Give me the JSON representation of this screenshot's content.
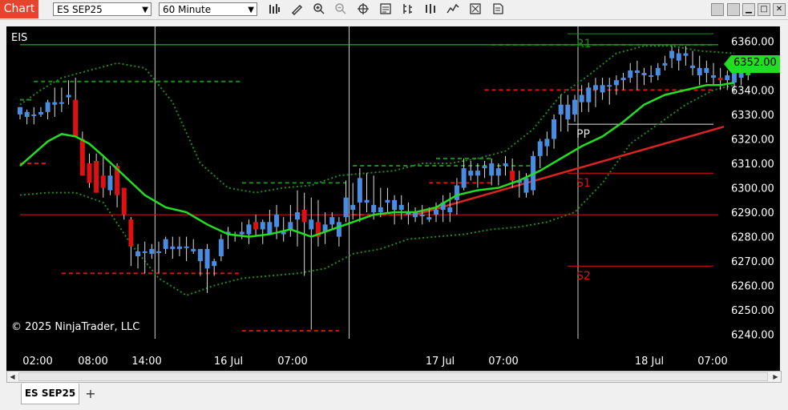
{
  "toolbar": {
    "chart_tab_label": "Chart",
    "instrument": "ES SEP25",
    "interval": "60 Minute",
    "tools": [
      "bar-type-icon",
      "draw-pencil-icon",
      "zoom-in-icon",
      "zoom-out-icon",
      "crosshair-icon",
      "data-box-icon",
      "indicators-icon",
      "strategies-icon",
      "chart-style-icon",
      "properties-icon",
      "templates-icon"
    ],
    "window_buttons": [
      "minimize",
      "restore",
      "maximize",
      "close"
    ]
  },
  "chart": {
    "instrument_label": "EIS",
    "copyright": "© 2025 NinjaTrader, LLC",
    "current_price": "6352.00",
    "pivot_labels": {
      "r1": "R1",
      "pp": "PP",
      "s1": "S1",
      "s2": "S2"
    },
    "colors": {
      "background": "#000000",
      "up_candle": "#22cc22",
      "down_candle": "#dd1111",
      "neutral_candle": "#4a8de0",
      "sma": "#22dd22",
      "bollinger": "#1e8a1e",
      "trendline": "#dd2222",
      "price_marker": "#22dd22"
    }
  },
  "chart_data": {
    "type": "candlestick",
    "ylim": [
      6235,
      6366
    ],
    "y_ticks": [
      "6360.00",
      "6350.00",
      "6340.00",
      "6330.00",
      "6320.00",
      "6310.00",
      "6300.00",
      "6290.00",
      "6280.00",
      "6270.00",
      "6260.00",
      "6250.00",
      "6240.00"
    ],
    "x_ticks": [
      "02:00",
      "08:00",
      "14:00",
      "16 Jul",
      "07:00",
      "17 Jul",
      "07:00",
      "18 Jul",
      "07:00"
    ],
    "candles": [
      [
        6333,
        6333,
        6328,
        6330,
        "b"
      ],
      [
        6331,
        6332,
        6326,
        6329,
        "b"
      ],
      [
        6330,
        6333,
        6326,
        6330,
        "b"
      ],
      [
        6330,
        6333,
        6329,
        6331,
        "b"
      ],
      [
        6331,
        6336,
        6328,
        6335,
        "b"
      ],
      [
        6334,
        6341,
        6329,
        6335,
        "b"
      ],
      [
        6335,
        6341,
        6331,
        6335,
        "b"
      ],
      [
        6338,
        6344,
        6334,
        6337,
        "b"
      ],
      [
        6336,
        6345,
        6330,
        6321,
        "r"
      ],
      [
        6320,
        6323,
        6305,
        6305,
        "r"
      ],
      [
        6310,
        6314,
        6300,
        6302,
        "r"
      ],
      [
        6311,
        6314,
        6298,
        6298,
        "r"
      ],
      [
        6305,
        6313,
        6296,
        6300,
        "r"
      ],
      [
        6299,
        6309,
        6297,
        6305,
        "b"
      ],
      [
        6309,
        6310,
        6292,
        6297,
        "r"
      ],
      [
        6300,
        6300,
        6287,
        6289,
        "r"
      ],
      [
        6287,
        6288,
        6268,
        6276,
        "r"
      ],
      [
        6272,
        6277,
        6267,
        6274,
        "b"
      ],
      [
        6274,
        6278,
        6265,
        6274,
        "b"
      ],
      [
        6273,
        6277,
        6271,
        6275,
        "b"
      ],
      [
        6274,
        6278,
        6265,
        6274,
        "b"
      ],
      [
        6279,
        6280,
        6273,
        6275,
        "b"
      ],
      [
        6275,
        6280,
        6271,
        6276,
        "b"
      ],
      [
        6276,
        6280,
        6272,
        6275,
        "b"
      ],
      [
        6276,
        6280,
        6270,
        6276,
        "b"
      ],
      [
        6274,
        6279,
        6273,
        6275,
        "b"
      ],
      [
        6270,
        6274,
        6264,
        6275,
        "b"
      ],
      [
        6275,
        6277,
        6257,
        6267,
        "b"
      ],
      [
        6268,
        6271,
        6264,
        6270,
        "b"
      ],
      [
        6272,
        6281,
        6270,
        6279,
        "b"
      ],
      [
        6282,
        6284,
        6275,
        6282,
        "b"
      ],
      [
        6281,
        6282,
        6278,
        6281,
        "b"
      ],
      [
        6282,
        6286,
        6279,
        6281,
        "b"
      ],
      [
        6281,
        6287,
        6277,
        6285,
        "b"
      ],
      [
        6286,
        6289,
        6280,
        6283,
        "r"
      ],
      [
        6283,
        6287,
        6277,
        6286,
        "b"
      ],
      [
        6286,
        6291,
        6281,
        6281,
        "b"
      ],
      [
        6289,
        6293,
        6279,
        6284,
        "b"
      ],
      [
        6282,
        6288,
        6278,
        6281,
        "b"
      ],
      [
        6283,
        6293,
        6280,
        6286,
        "b"
      ],
      [
        6287,
        6299,
        6276,
        6290,
        "b"
      ],
      [
        6291,
        6298,
        6264,
        6286,
        "r"
      ],
      [
        6287,
        6296,
        6242,
        6283,
        "b"
      ],
      [
        6286,
        6295,
        6276,
        6280,
        "r"
      ],
      [
        6282,
        6290,
        6277,
        6285,
        "b"
      ],
      [
        6285,
        6290,
        6283,
        6288,
        "b"
      ],
      [
        6286,
        6288,
        6276,
        6280,
        "b"
      ],
      [
        6288,
        6303,
        6286,
        6296,
        "b"
      ],
      [
        6293,
        6302,
        6287,
        6291,
        "b"
      ],
      [
        6294,
        6308,
        6286,
        6304,
        "b"
      ],
      [
        6295,
        6306,
        6290,
        6294,
        "b"
      ],
      [
        6293,
        6305,
        6287,
        6290,
        "b"
      ],
      [
        6290,
        6300,
        6288,
        6292,
        "b"
      ],
      [
        6295,
        6300,
        6290,
        6294,
        "b"
      ],
      [
        6291,
        6297,
        6285,
        6295,
        "b"
      ],
      [
        6291,
        6297,
        6287,
        6293,
        "b"
      ],
      [
        6289,
        6294,
        6285,
        6290,
        "b"
      ],
      [
        6288,
        6292,
        6286,
        6290,
        "b"
      ],
      [
        6289,
        6293,
        6285,
        6289,
        "b"
      ],
      [
        6288,
        6292,
        6286,
        6287,
        "b"
      ],
      [
        6289,
        6294,
        6286,
        6291,
        "b"
      ],
      [
        6291,
        6297,
        6286,
        6294,
        "b"
      ],
      [
        6290,
        6298,
        6286,
        6292,
        "b"
      ],
      [
        6295,
        6304,
        6289,
        6301,
        "b"
      ],
      [
        6300,
        6312,
        6299,
        6308,
        "b"
      ],
      [
        6307,
        6311,
        6303,
        6305,
        "b"
      ],
      [
        6305,
        6310,
        6300,
        6307,
        "b"
      ],
      [
        6308,
        6311,
        6304,
        6309,
        "b"
      ],
      [
        6305,
        6312,
        6301,
        6310,
        "b"
      ],
      [
        6305,
        6310,
        6301,
        6308,
        "b"
      ],
      [
        6310,
        6313,
        6305,
        6309,
        "b"
      ],
      [
        6307,
        6312,
        6300,
        6303,
        "r"
      ],
      [
        6303,
        6307,
        6296,
        6302,
        "b"
      ],
      [
        6298,
        6306,
        6296,
        6304,
        "b"
      ],
      [
        6299,
        6315,
        6297,
        6313,
        "b"
      ],
      [
        6313,
        6320,
        6308,
        6319,
        "b"
      ],
      [
        6317,
        6323,
        6313,
        6320,
        "b"
      ],
      [
        6320,
        6330,
        6316,
        6328,
        "b"
      ],
      [
        6330,
        6338,
        6323,
        6334,
        "b"
      ],
      [
        6328,
        6338,
        6323,
        6334,
        "b"
      ],
      [
        6330,
        6338,
        6327,
        6336,
        "b"
      ],
      [
        6338,
        6342,
        6331,
        6335,
        "b"
      ],
      [
        6335,
        6343,
        6331,
        6341,
        "b"
      ],
      [
        6340,
        6345,
        6333,
        6342,
        "b"
      ],
      [
        6339,
        6345,
        6336,
        6342,
        "b"
      ],
      [
        6342,
        6345,
        6334,
        6342,
        "b"
      ],
      [
        6342,
        6346,
        6338,
        6344,
        "b"
      ],
      [
        6344,
        6347,
        6340,
        6345,
        "b"
      ],
      [
        6345,
        6351,
        6343,
        6348,
        "b"
      ],
      [
        6347,
        6352,
        6340,
        6348,
        "b"
      ],
      [
        6346,
        6349,
        6342,
        6347,
        "b"
      ],
      [
        6346,
        6350,
        6343,
        6346,
        "b"
      ],
      [
        6346,
        6351,
        6344,
        6349,
        "b"
      ],
      [
        6351,
        6354,
        6348,
        6350,
        "b"
      ],
      [
        6353,
        6358,
        6349,
        6356,
        "b"
      ],
      [
        6352,
        6357,
        6348,
        6355,
        "b"
      ],
      [
        6355,
        6358,
        6350,
        6354,
        "b"
      ],
      [
        6350,
        6356,
        6346,
        6349,
        "b"
      ],
      [
        6349,
        6354,
        6342,
        6346,
        "b"
      ],
      [
        6347,
        6352,
        6343,
        6349,
        "b"
      ],
      [
        6346,
        6351,
        6342,
        6345,
        "b"
      ],
      [
        6345,
        6349,
        6340,
        6344,
        "r"
      ],
      [
        6344,
        6348,
        6340,
        6346,
        "b"
      ],
      [
        6343,
        6349,
        6339,
        6347,
        "b"
      ],
      [
        6345,
        6350,
        6342,
        6348,
        "b"
      ],
      [
        6346,
        6352,
        6344,
        6352,
        "g"
      ]
    ],
    "sma": [
      [
        0,
        6309
      ],
      [
        2,
        6314
      ],
      [
        4,
        6319
      ],
      [
        6,
        6322
      ],
      [
        8,
        6321
      ],
      [
        10,
        6318
      ],
      [
        12,
        6313
      ],
      [
        15,
        6305
      ],
      [
        18,
        6297
      ],
      [
        21,
        6292
      ],
      [
        24,
        6290
      ],
      [
        27,
        6285
      ],
      [
        30,
        6281
      ],
      [
        33,
        6280
      ],
      [
        36,
        6281
      ],
      [
        39,
        6283
      ],
      [
        42,
        6280
      ],
      [
        45,
        6283
      ],
      [
        48,
        6286
      ],
      [
        51,
        6289
      ],
      [
        54,
        6290
      ],
      [
        57,
        6290
      ],
      [
        60,
        6292
      ],
      [
        63,
        6297
      ],
      [
        66,
        6299
      ],
      [
        69,
        6300
      ],
      [
        72,
        6303
      ],
      [
        75,
        6307
      ],
      [
        78,
        6312
      ],
      [
        81,
        6317
      ],
      [
        84,
        6321
      ],
      [
        87,
        6327
      ],
      [
        90,
        6334
      ],
      [
        93,
        6338
      ],
      [
        96,
        6340
      ],
      [
        99,
        6342
      ],
      [
        101,
        6342
      ],
      [
        103,
        6343
      ]
    ],
    "bollinger_upper": [
      [
        0,
        6334
      ],
      [
        3,
        6340
      ],
      [
        6,
        6345
      ],
      [
        10,
        6348
      ],
      [
        14,
        6351
      ],
      [
        18,
        6349
      ],
      [
        22,
        6335
      ],
      [
        26,
        6310
      ],
      [
        30,
        6300
      ],
      [
        34,
        6298
      ],
      [
        38,
        6300
      ],
      [
        42,
        6301
      ],
      [
        46,
        6305
      ],
      [
        50,
        6306
      ],
      [
        54,
        6307
      ],
      [
        58,
        6310
      ],
      [
        62,
        6310
      ],
      [
        66,
        6312
      ],
      [
        70,
        6315
      ],
      [
        74,
        6324
      ],
      [
        78,
        6338
      ],
      [
        82,
        6346
      ],
      [
        86,
        6355
      ],
      [
        90,
        6358
      ],
      [
        94,
        6358
      ],
      [
        98,
        6356
      ],
      [
        103,
        6355
      ]
    ],
    "bollinger_lower": [
      [
        0,
        6297
      ],
      [
        4,
        6298
      ],
      [
        8,
        6298
      ],
      [
        12,
        6294
      ],
      [
        16,
        6277
      ],
      [
        20,
        6263
      ],
      [
        24,
        6256
      ],
      [
        28,
        6260
      ],
      [
        32,
        6263
      ],
      [
        36,
        6264
      ],
      [
        40,
        6265
      ],
      [
        44,
        6267
      ],
      [
        48,
        6273
      ],
      [
        52,
        6275
      ],
      [
        56,
        6279
      ],
      [
        60,
        6280
      ],
      [
        64,
        6281
      ],
      [
        68,
        6283
      ],
      [
        72,
        6284
      ],
      [
        76,
        6286
      ],
      [
        80,
        6290
      ],
      [
        84,
        6302
      ],
      [
        88,
        6318
      ],
      [
        92,
        6326
      ],
      [
        96,
        6334
      ],
      [
        100,
        6340
      ],
      [
        103,
        6342
      ]
    ],
    "trendline": {
      "x0": 57,
      "y0": 6289,
      "x1": 103,
      "y1": 6325
    },
    "horizontal_lines": [
      {
        "price": 6358.5,
        "style": "solid",
        "color": "#22dd22",
        "from": 0,
        "to": 103
      },
      {
        "price": 6289.0,
        "style": "solid",
        "color": "#dd1111",
        "from": 0,
        "to": 103
      }
    ],
    "dashed_levels": [
      {
        "price": 6336.0,
        "from": 0,
        "to": 2,
        "color": "#1e8a1e"
      },
      {
        "price": 6343.5,
        "from": 2,
        "to": 32,
        "color": "#1e8a1e"
      },
      {
        "price": 6310.0,
        "from": 0,
        "to": 4,
        "color": "#dd1111"
      },
      {
        "price": 6302.0,
        "from": 32,
        "to": 47,
        "color": "#1e8a1e"
      },
      {
        "price": 6265.0,
        "from": 6,
        "to": 32,
        "color": "#dd1111"
      },
      {
        "price": 6241.5,
        "from": 32,
        "to": 46,
        "color": "#dd1111"
      },
      {
        "price": 6309.0,
        "from": 48,
        "to": 74,
        "color": "#1e8a1e"
      },
      {
        "price": 6289.0,
        "from": 48,
        "to": 57,
        "color": "#dd1111"
      },
      {
        "price": 6312.0,
        "from": 60,
        "to": 68,
        "color": "#1e8a1e"
      },
      {
        "price": 6302.0,
        "from": 59,
        "to": 68,
        "color": "#dd1111"
      },
      {
        "price": 6358.5,
        "from": 68,
        "to": 100,
        "color": "#1e8a1e"
      },
      {
        "price": 6340.0,
        "from": 67,
        "to": 100,
        "color": "#dd1111"
      }
    ],
    "pivots": [
      {
        "name": "R1",
        "price": 6363.0,
        "color": "#1e8a1e"
      },
      {
        "name": "PP",
        "price": 6326.0,
        "color": "#e6e6e6"
      },
      {
        "name": "S1",
        "price": 6306.0,
        "color": "#dd1111"
      },
      {
        "name": "S2",
        "price": 6268.0,
        "color": "#dd1111"
      }
    ],
    "session_breaks": [
      19,
      47,
      80
    ]
  }
}
